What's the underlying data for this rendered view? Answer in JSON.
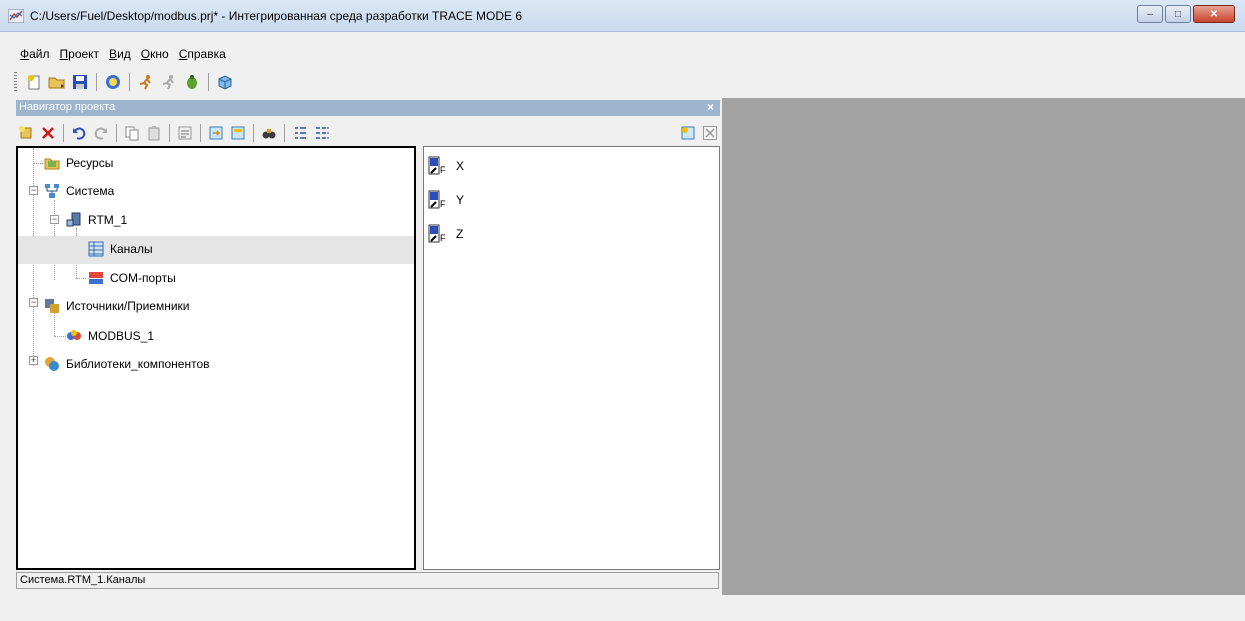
{
  "window": {
    "title": "C:/Users/Fuel/Desktop/modbus.prj* - Интегрированная среда разработки TRACE MODE 6",
    "buttons": {
      "minimize": "–",
      "maximize": "□",
      "close": "✕"
    }
  },
  "menu": [
    {
      "underline": "Ф",
      "rest": "айл"
    },
    {
      "underline": "П",
      "rest": "роект"
    },
    {
      "underline": "В",
      "rest": "ид"
    },
    {
      "underline": "О",
      "rest": "кно"
    },
    {
      "underline": "С",
      "rest": "правка"
    }
  ],
  "navigator": {
    "title": "Навигатор проекта",
    "close": "×"
  },
  "tree": [
    {
      "label": "Ресурсы"
    },
    {
      "label": "Система"
    },
    {
      "label": "RTM_1"
    },
    {
      "label": "Каналы"
    },
    {
      "label": "COM-порты"
    },
    {
      "label": "Источники/Приемники"
    },
    {
      "label": "MODBUS_1"
    },
    {
      "label": "Библиотеки_компонентов"
    }
  ],
  "channels": [
    {
      "label": "X"
    },
    {
      "label": "Y"
    },
    {
      "label": "Z"
    }
  ],
  "status": {
    "path": "Система.RTM_1.Каналы"
  },
  "colors": {
    "accent": "#9eb5d0",
    "workspace": "#a3a3a3"
  }
}
